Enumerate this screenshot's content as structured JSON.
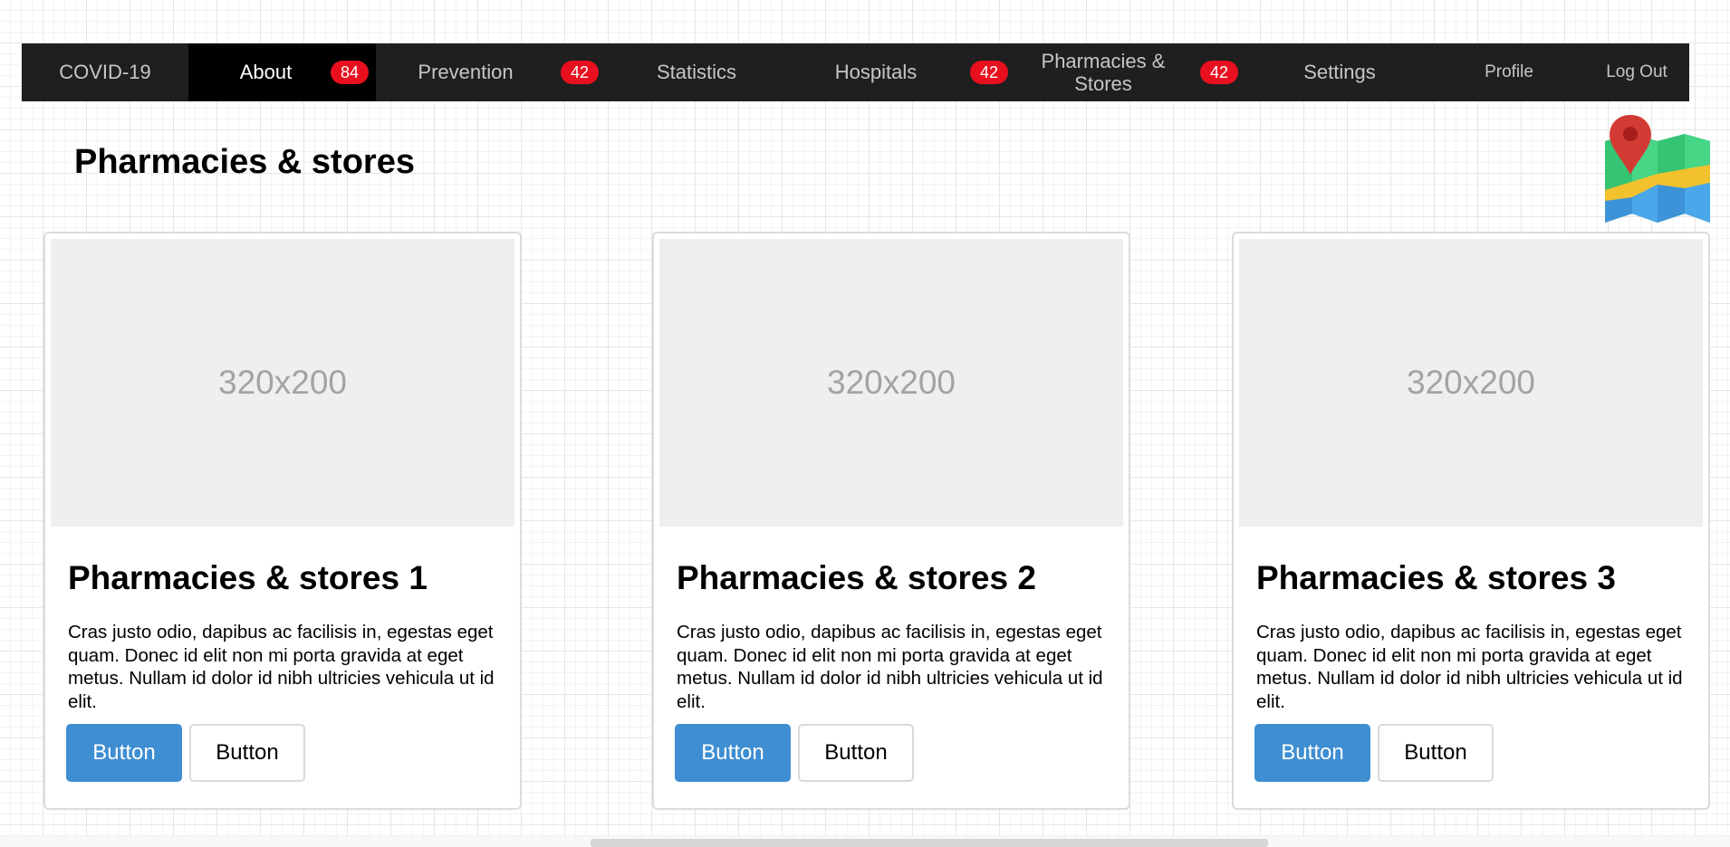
{
  "nav": [
    {
      "label": "COVID-19",
      "badge": null,
      "active": false
    },
    {
      "label": "About",
      "badge": "84",
      "active": true
    },
    {
      "label": "Prevention",
      "badge": "42",
      "active": false
    },
    {
      "label": "Statistics",
      "badge": null,
      "active": false
    },
    {
      "label": "Hospitals",
      "badge": "42",
      "active": false
    },
    {
      "label": "Pharmacies & Stores",
      "badge": "42",
      "active": false
    },
    {
      "label": "Settings",
      "badge": null,
      "active": false
    },
    {
      "label": "Profile",
      "badge": null,
      "active": false
    },
    {
      "label": "Log Out",
      "badge": null,
      "active": false
    }
  ],
  "page": {
    "title": "Pharmacies & stores",
    "icon": "map-location-icon"
  },
  "cards": [
    {
      "image_placeholder": "320x200",
      "title": "Pharmacies & stores 1",
      "text": "Cras justo odio, dapibus ac facilisis in, egestas eget quam. Donec id elit non mi porta gravida at eget metus. Nullam id dolor id nibh ultricies vehicula ut id elit.",
      "primary_button": "Button",
      "secondary_button": "Button"
    },
    {
      "image_placeholder": "320x200",
      "title": "Pharmacies & stores 2",
      "text": "Cras justo odio, dapibus ac facilisis in, egestas eget quam. Donec id elit non mi porta gravida at eget metus. Nullam id dolor id nibh ultricies vehicula ut id elit.",
      "primary_button": "Button",
      "secondary_button": "Button"
    },
    {
      "image_placeholder": "320x200",
      "title": "Pharmacies & stores 3",
      "text": "Cras justo odio, dapibus ac facilisis in, egestas eget quam. Donec id elit non mi porta gravida at eget metus. Nullam id dolor id nibh ultricies vehicula ut id elit.",
      "primary_button": "Button",
      "secondary_button": "Button"
    }
  ],
  "colors": {
    "navbar_bg": "#1f1f1f",
    "nav_active_bg": "#000000",
    "badge": "#e8101f",
    "primary_button": "#3f8ed2"
  }
}
